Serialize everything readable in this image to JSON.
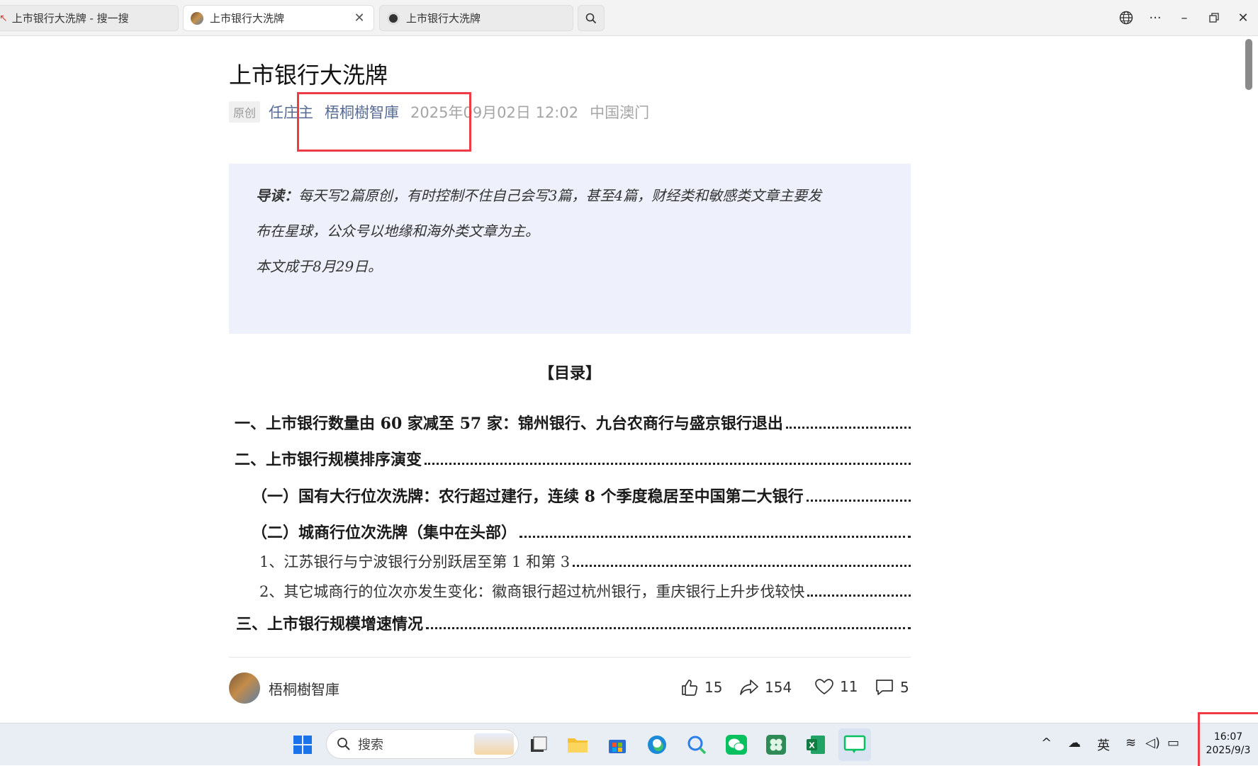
{
  "tabs": [
    {
      "title": "上市银行大洗牌 - 搜一搜",
      "active": false
    },
    {
      "title": "上市银行大洗牌",
      "active": true
    },
    {
      "title": "上市银行大洗牌",
      "active": false
    }
  ],
  "article": {
    "title": "上市银行大洗牌",
    "badge": "原创",
    "author": "任庄主",
    "account": "梧桐樹智庫",
    "datetime": "2025年09月02日 12:02",
    "location": "中国澳门",
    "intro_label": "导读：",
    "intro_line1": "每天写2篇原创，有时控制不住自己会写3篇，甚至4篇，财经类和敏感类文章主要发",
    "intro_line2": "布在星球，公众号以地缘和海外类文章为主。",
    "intro_line3": "本文成于8月29日。",
    "toc_title": "【目录】",
    "toc": [
      "一、上市银行数量由 60 家减至 57 家：锦州银行、九台农商行与盛京银行退出",
      "二、上市银行规模排序演变",
      "（一）国有大行位次洗牌：农行超过建行，连续 8 个季度稳居至中国第二大银行",
      "（二）城商行位次洗牌（集中在头部）",
      "1、江苏银行与宁波银行分别跃居至第 1 和第 3",
      "2、其它城商行的位次亦发生变化：徽商银行超过杭州银行，重庆银行上升步伐较快",
      "三、上市银行规模增速情况"
    ]
  },
  "footer": {
    "account_name": "梧桐樹智庫",
    "likes": "15",
    "shares": "154",
    "favorites": "11",
    "comments": "5"
  },
  "taskbar": {
    "search_placeholder": "搜索",
    "ime": "英",
    "time": "16:07",
    "date": "2025/9/3"
  },
  "colors": {
    "link": "#576b95",
    "intro_bg": "#eef1fb",
    "highlight": "#ee3b45"
  }
}
